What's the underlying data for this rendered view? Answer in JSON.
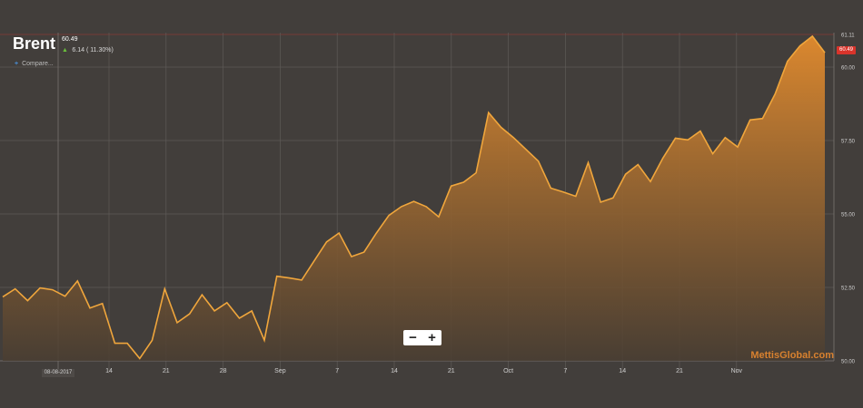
{
  "header": {
    "title": "Brent",
    "last_price": "60.49",
    "change": "6.14 ( 11.30%)",
    "compare_label": "Compare..."
  },
  "last_price_badge": "60.49",
  "zoom_controls": {
    "minus": "−",
    "plus": "+"
  },
  "watermark": "MettisGlobal.com",
  "crosshair_date": "08-08-2017",
  "colors": {
    "background": "#423e3b",
    "line": "#f0a63c",
    "fill_top": "#e08a2e",
    "fill_bottom": "#4a3e32",
    "grid": "#5e5a57",
    "badge": "#d9342b"
  },
  "chart_data": {
    "type": "area",
    "title": "Brent",
    "y_axis_side": "right",
    "ylim": [
      50.0,
      61.11
    ],
    "y_ticks": [
      "50.00",
      "52.50",
      "55.00",
      "57.50",
      "60.00",
      "61.11"
    ],
    "x_ticks": [
      "14",
      "21",
      "28",
      "Sep",
      "7",
      "14",
      "21",
      "Oct",
      "7",
      "14",
      "21",
      "Nov"
    ],
    "grid": true,
    "series": [
      {
        "values": [
          52.18,
          52.45,
          52.05,
          52.48,
          52.42,
          52.2,
          52.72,
          51.8,
          51.95,
          50.6,
          50.6,
          50.08,
          50.7,
          52.45,
          51.3,
          51.6,
          52.25,
          51.7,
          51.98,
          51.45,
          51.7,
          50.7,
          52.88,
          52.82,
          52.75,
          53.4,
          54.05,
          54.35,
          53.55,
          53.7,
          54.35,
          54.95,
          55.25,
          55.43,
          55.25,
          54.9,
          55.95,
          56.08,
          56.4,
          58.45,
          57.95,
          57.6,
          57.2,
          56.8,
          55.88,
          55.75,
          55.6,
          56.75,
          55.4,
          55.55,
          56.35,
          56.68,
          56.1,
          56.9,
          57.58,
          57.52,
          57.82,
          57.05,
          57.6,
          57.28,
          58.2,
          58.25,
          59.08,
          60.2,
          60.72,
          61.05,
          60.49
        ]
      }
    ],
    "last_value": 60.49,
    "min_value": 50.08,
    "max_value": 61.11
  }
}
